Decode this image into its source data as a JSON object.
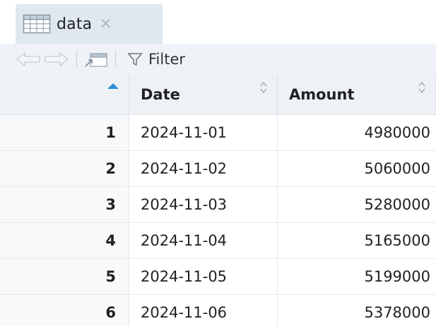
{
  "tab": {
    "label": "data",
    "close_glyph": "×",
    "icon": "table-icon"
  },
  "toolbar": {
    "back_icon": "back-arrow-icon",
    "forward_icon": "forward-arrow-icon",
    "popout_icon": "popout-icon",
    "filter_icon": "filter-icon",
    "filter_label": "Filter"
  },
  "grid": {
    "columns": [
      "Date",
      "Amount"
    ],
    "rows": [
      {
        "index": "1",
        "date": "2024-11-01",
        "amount": "4980000"
      },
      {
        "index": "2",
        "date": "2024-11-02",
        "amount": "5060000"
      },
      {
        "index": "3",
        "date": "2024-11-03",
        "amount": "5280000"
      },
      {
        "index": "4",
        "date": "2024-11-04",
        "amount": "5165000"
      },
      {
        "index": "5",
        "date": "2024-11-05",
        "amount": "5199000"
      },
      {
        "index": "6",
        "date": "2024-11-06",
        "amount": "5378000"
      }
    ]
  },
  "colors": {
    "tab_bg": "#dfe7ef",
    "toolbar_bg": "#eff3f7",
    "header_bg": "#eef2f6",
    "sort_accent": "#2f8fd8"
  }
}
